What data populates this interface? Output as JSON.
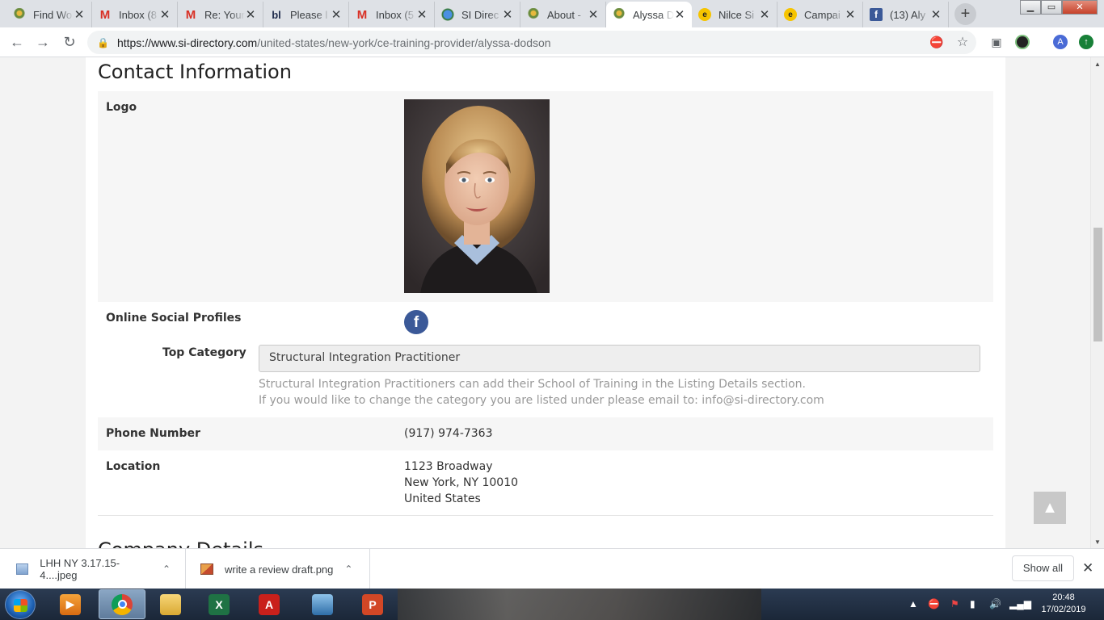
{
  "browser": {
    "tabs": [
      {
        "title": "Find Wo",
        "favicon": "tree-icon"
      },
      {
        "title": "Inbox (8",
        "favicon": "gmail-icon"
      },
      {
        "title": "Re: Your",
        "favicon": "gmail-icon"
      },
      {
        "title": "Please l",
        "favicon": "bl-icon"
      },
      {
        "title": "Inbox (5",
        "favicon": "gmail-icon"
      },
      {
        "title": "SI Direc",
        "favicon": "globe-icon"
      },
      {
        "title": "About -",
        "favicon": "tree-icon"
      },
      {
        "title": "Alyssa D",
        "favicon": "tree-icon",
        "active": true
      },
      {
        "title": "Nilce Si",
        "favicon": "mailchimp-icon"
      },
      {
        "title": "Campai",
        "favicon": "mailchimp-icon"
      },
      {
        "title": "(13) Aly",
        "favicon": "facebook-icon"
      }
    ],
    "tab_close_glyph": "✕",
    "new_tab_glyph": "+",
    "url_host": "https://www.si-directory.com",
    "url_path": "/united-states/new-york/ce-training-provider/alyssa-dodson",
    "profile_initial": "A"
  },
  "page": {
    "section_title": "Contact Information",
    "logo_label": "Logo",
    "social_label": "Online Social Profiles",
    "facebook_glyph": "f",
    "top_category_label": "Top Category",
    "top_category_value": "Structural Integration Practitioner",
    "help_line_1": "Structural Integration Practitioners can add their School of Training in the Listing Details section.",
    "help_line_2": "If you would like to change the category you are listed under please email to: info@si-directory.com",
    "phone_label": "Phone Number",
    "phone_value": "(917) 974-7363",
    "location_label": "Location",
    "address_line_1": "1123 Broadway",
    "address_line_2": "New York, NY 10010",
    "address_line_3": "United States",
    "next_section_title": "Company Details"
  },
  "downloads": {
    "items": [
      {
        "name": "LHH NY 3.17.15-4....jpeg"
      },
      {
        "name": "write a review draft.png"
      }
    ],
    "show_all_label": "Show all"
  },
  "taskbar": {
    "time": "20:48",
    "date": "17/02/2019"
  },
  "colors": {
    "facebook": "#3b5998",
    "page_background": "#ffffff",
    "row_shade": "#f6f6f6"
  }
}
